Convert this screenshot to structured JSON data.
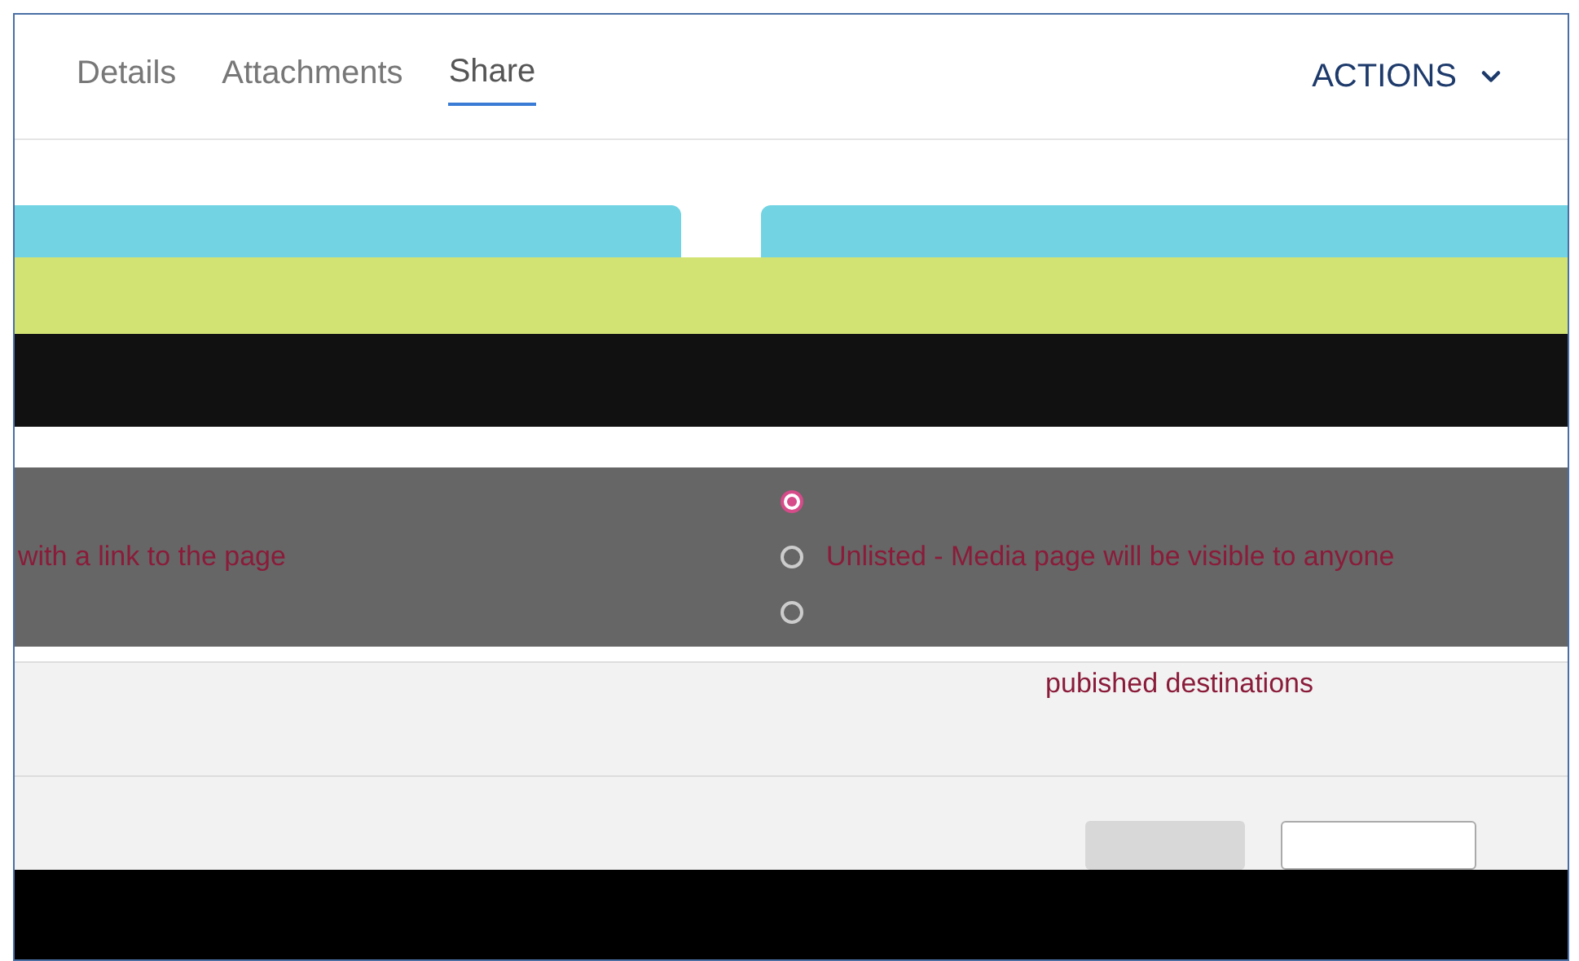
{
  "tabs": [
    {
      "label": "Details",
      "selected": false
    },
    {
      "label": "Attachments",
      "selected": false
    },
    {
      "label": "Share",
      "selected": true
    }
  ],
  "actions": {
    "label": "ACTIONS"
  },
  "left_note": "with a link to the page",
  "options": [
    {
      "selected": true
    },
    {
      "label": "Unlisted - Media page will be visible to anyone",
      "selected": false
    },
    {
      "selected": false
    }
  ],
  "options_footer": "pubished destinations"
}
